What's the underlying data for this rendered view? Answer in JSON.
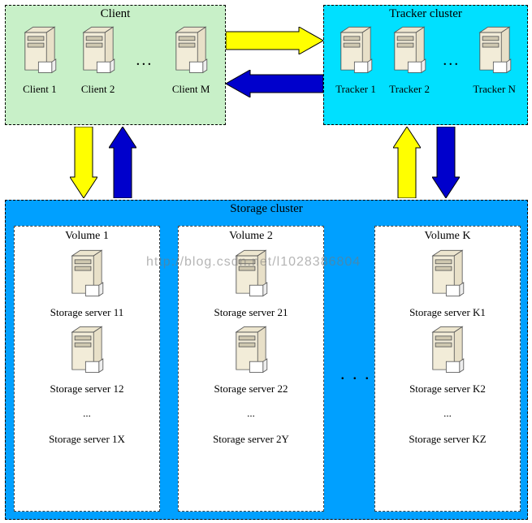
{
  "clusters": {
    "client": {
      "title": "Client",
      "nodes": [
        "Client 1",
        "Client 2",
        "Client M"
      ],
      "ellipsis": "..."
    },
    "tracker": {
      "title": "Tracker cluster",
      "nodes": [
        "Tracker 1",
        "Tracker 2",
        "Tracker N"
      ],
      "ellipsis": "..."
    },
    "storage": {
      "title": "Storage cluster",
      "ellipsis": ". . .",
      "volumes": [
        {
          "title": "Volume 1",
          "servers": [
            "Storage server 11",
            "Storage server 12"
          ],
          "etc": "...",
          "last": "Storage server 1X"
        },
        {
          "title": "Volume 2",
          "servers": [
            "Storage server 21",
            "Storage server 22"
          ],
          "etc": "...",
          "last": "Storage server 2Y"
        },
        {
          "title": "Volume K",
          "servers": [
            "Storage server K1",
            "Storage server K2"
          ],
          "etc": "...",
          "last": "Storage server KZ"
        }
      ]
    }
  },
  "watermark": "http://blog.csdn.net/l1028386804",
  "colors": {
    "yellow": "#ffff00",
    "blue": "#0000cc"
  }
}
